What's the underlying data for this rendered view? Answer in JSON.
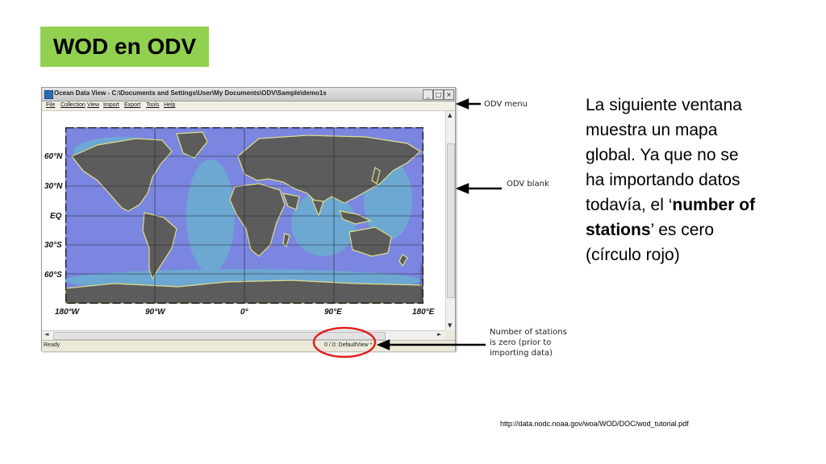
{
  "slide": {
    "title": "WOD en ODV",
    "description_lines": [
      {
        "text": "La siguiente ventana"
      },
      {
        "text": "muestra un mapa"
      },
      {
        "text": "global. Ya que no se"
      },
      {
        "text": "ha importando datos"
      },
      {
        "text": "todavía, el ‘",
        "bold": "number of"
      },
      {
        "bold": "stations",
        "text": "’ es cero"
      },
      {
        "text": "(círculo rojo)"
      }
    ],
    "url": "http://data.nodc.noaa.gov/woa/WOD/DOC/wod_tutorial.pdf"
  },
  "window": {
    "title": "Ocean Data View - C:\\Documents and Settings\\User\\My Documents\\ODV\\Sample\\demo1s",
    "menu": [
      "File",
      "Collection",
      "View",
      "Import",
      "Export",
      "Tools",
      "Help"
    ],
    "lat_labels": [
      "60°N",
      "30°N",
      "EQ",
      "30°S",
      "60°S"
    ],
    "lon_labels": [
      "180°W",
      "90°W",
      "0°",
      "90°E",
      "180°E"
    ],
    "watermark": "Ocean Data View",
    "status_left": "Ready",
    "status_view": "0 / 0: DefaultView *",
    "buttons": {
      "minimize": "_",
      "maximize": "□",
      "close": "×"
    },
    "scroll": {
      "up": "▲",
      "down": "▼",
      "left": "◄",
      "right": "►"
    }
  },
  "annotations": {
    "menu": "ODV menu",
    "blank": "ODV blank",
    "stations": [
      "Number of stations",
      "is zero (prior to",
      "importing data)"
    ]
  },
  "colors": {
    "title_bg": "#92d050",
    "ocean": "#7b86e0",
    "land": "#5c5c5c",
    "circle": "#e02020"
  }
}
